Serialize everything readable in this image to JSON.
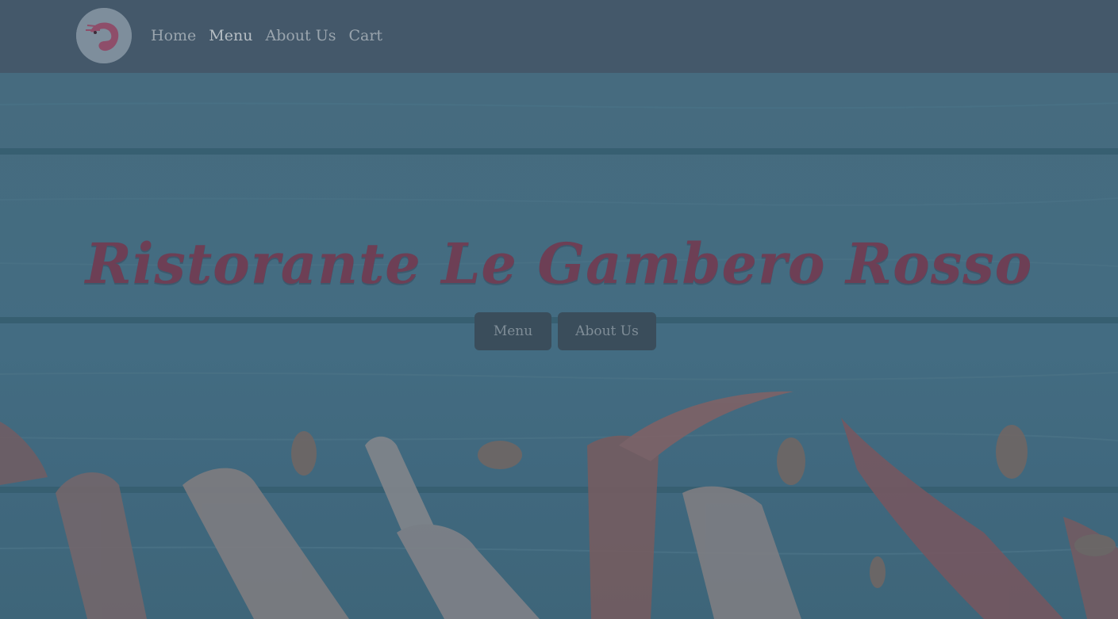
{
  "nav": {
    "logo": "shrimp-logo",
    "links": [
      {
        "label": "Home"
      },
      {
        "label": "Menu"
      },
      {
        "label": "About Us"
      },
      {
        "label": "Cart"
      }
    ]
  },
  "hero": {
    "title": "Ristorante Le Gambero Rosso",
    "buttons": [
      {
        "label": "Menu"
      },
      {
        "label": "About Us"
      }
    ]
  },
  "colors": {
    "navbar": "#44586a",
    "hero_bg": "#477186",
    "title": "#6d3f55",
    "button_bg": "#3a4d5b"
  }
}
